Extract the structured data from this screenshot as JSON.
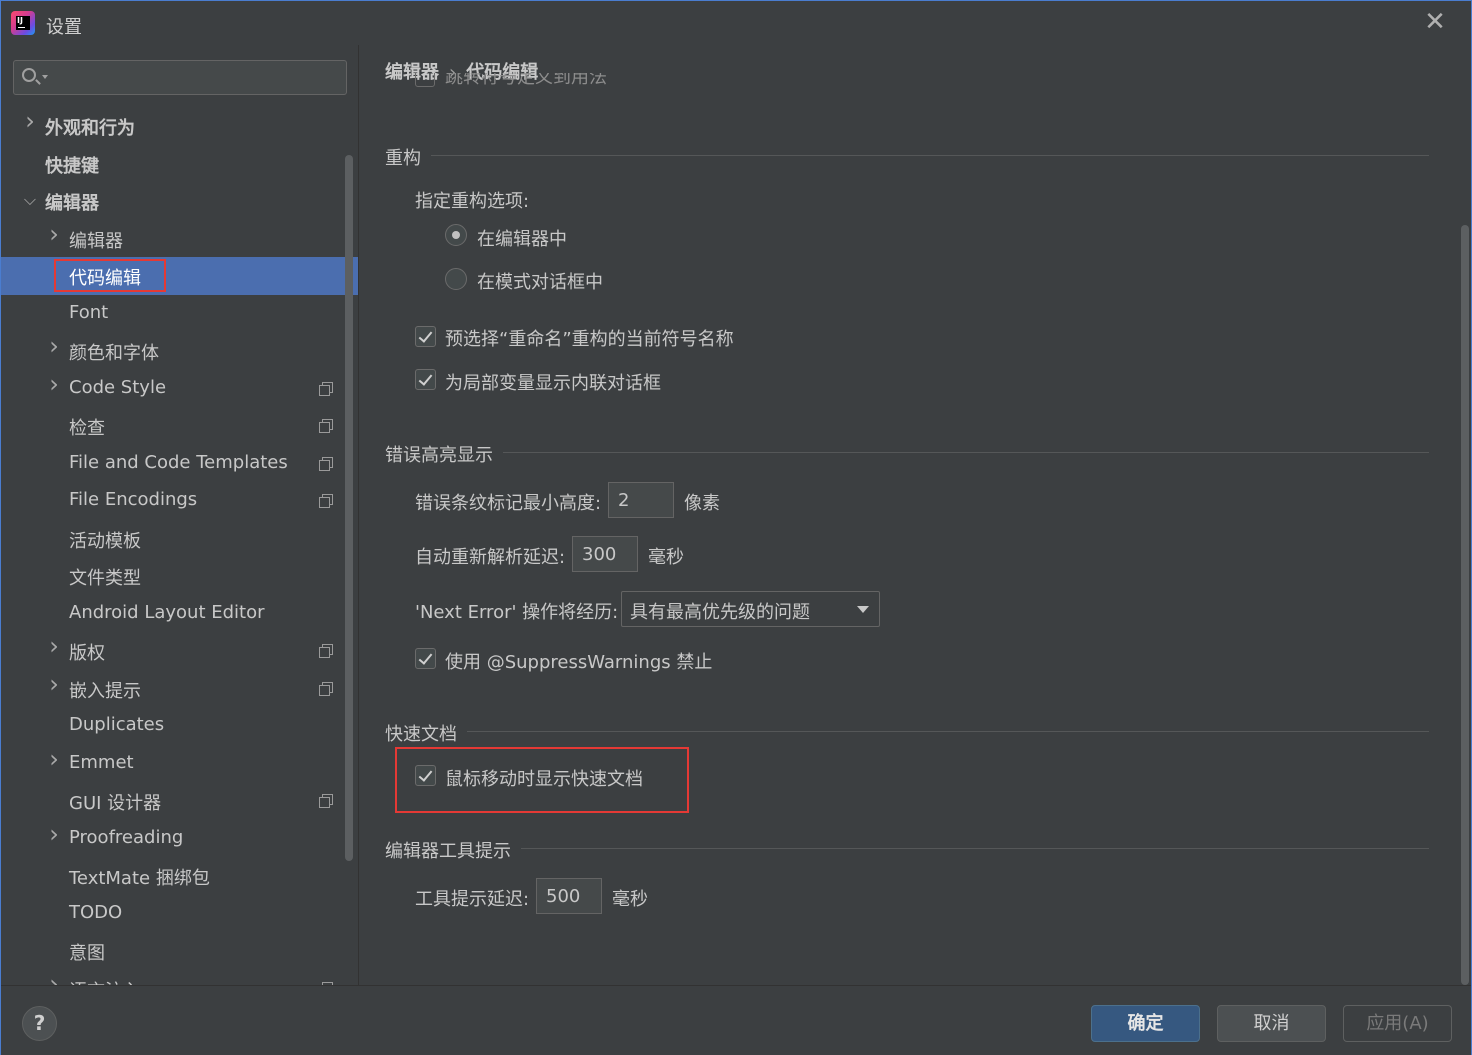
{
  "window": {
    "title": "设置",
    "close_glyph": "✕"
  },
  "search": {
    "value": "",
    "placeholder": ""
  },
  "sidebar": {
    "items": [
      {
        "label": "外观和行为",
        "level": 0,
        "chevron": "right",
        "bold": true,
        "copy": false
      },
      {
        "label": "快捷键",
        "level": 0,
        "chevron": "none",
        "bold": true,
        "copy": false
      },
      {
        "label": "编辑器",
        "level": 0,
        "chevron": "down",
        "bold": true,
        "copy": false
      },
      {
        "label": "编辑器",
        "level": 1,
        "chevron": "right",
        "bold": false,
        "copy": false
      },
      {
        "label": "代码编辑",
        "level": 1,
        "chevron": "none",
        "bold": false,
        "copy": false,
        "selected": true
      },
      {
        "label": "Font",
        "level": 1,
        "chevron": "none",
        "bold": false,
        "copy": false
      },
      {
        "label": "颜色和字体",
        "level": 1,
        "chevron": "right",
        "bold": false,
        "copy": false
      },
      {
        "label": "Code Style",
        "level": 1,
        "chevron": "right",
        "bold": false,
        "copy": true
      },
      {
        "label": "检查",
        "level": 1,
        "chevron": "none",
        "bold": false,
        "copy": true
      },
      {
        "label": "File and Code Templates",
        "level": 1,
        "chevron": "none",
        "bold": false,
        "copy": true
      },
      {
        "label": "File Encodings",
        "level": 1,
        "chevron": "none",
        "bold": false,
        "copy": true
      },
      {
        "label": "活动模板",
        "level": 1,
        "chevron": "none",
        "bold": false,
        "copy": false
      },
      {
        "label": "文件类型",
        "level": 1,
        "chevron": "none",
        "bold": false,
        "copy": false
      },
      {
        "label": "Android Layout Editor",
        "level": 1,
        "chevron": "none",
        "bold": false,
        "copy": false
      },
      {
        "label": "版权",
        "level": 1,
        "chevron": "right",
        "bold": false,
        "copy": true
      },
      {
        "label": "嵌入提示",
        "level": 1,
        "chevron": "right",
        "bold": false,
        "copy": true
      },
      {
        "label": "Duplicates",
        "level": 1,
        "chevron": "none",
        "bold": false,
        "copy": false
      },
      {
        "label": "Emmet",
        "level": 1,
        "chevron": "right",
        "bold": false,
        "copy": false
      },
      {
        "label": "GUI 设计器",
        "level": 1,
        "chevron": "none",
        "bold": false,
        "copy": true
      },
      {
        "label": "Proofreading",
        "level": 1,
        "chevron": "right",
        "bold": false,
        "copy": false
      },
      {
        "label": "TextMate 捆绑包",
        "level": 1,
        "chevron": "none",
        "bold": false,
        "copy": false
      },
      {
        "label": "TODO",
        "level": 1,
        "chevron": "none",
        "bold": false,
        "copy": false
      },
      {
        "label": "意图",
        "level": 1,
        "chevron": "none",
        "bold": false,
        "copy": false
      },
      {
        "label": "语言注入",
        "level": 1,
        "chevron": "right",
        "bold": false,
        "copy": true
      }
    ]
  },
  "main": {
    "breadcrumb": {
      "parent": "编辑器",
      "separator": "›",
      "current": "代码编辑"
    },
    "scrolled_partial_text": "跳转符号定义到用法",
    "refactoring": {
      "title": "重构",
      "specify_label": "指定重构选项:",
      "radio_in_editor": "在编辑器中",
      "radio_in_modal": "在模式对话框中",
      "preselect_rename": "预选择“重命名”重构的当前符号名称",
      "inline_dialog": "为局部变量显示内联对话框"
    },
    "error_highlighting": {
      "title": "错误高亮显示",
      "min_height_label": "错误条纹标记最小高度:",
      "min_height_value": "2",
      "min_height_unit": "像素",
      "reparse_label": "自动重新解析延迟:",
      "reparse_value": "300",
      "reparse_unit": "毫秒",
      "next_error_label": "'Next Error' 操作将经历:",
      "next_error_value": "具有最高优先级的问题",
      "suppress_label": "使用 @SuppressWarnings 禁止"
    },
    "quick_doc": {
      "title": "快速文档",
      "mouse_move_label": "鼠标移动时显示快速文档"
    },
    "editor_tooltips": {
      "title": "编辑器工具提示",
      "delay_label": "工具提示延迟:",
      "delay_value": "500",
      "delay_unit": "毫秒"
    }
  },
  "footer": {
    "help_label": "?",
    "ok_label": "确定",
    "cancel_label": "取消",
    "apply_label": "应用(A)"
  }
}
